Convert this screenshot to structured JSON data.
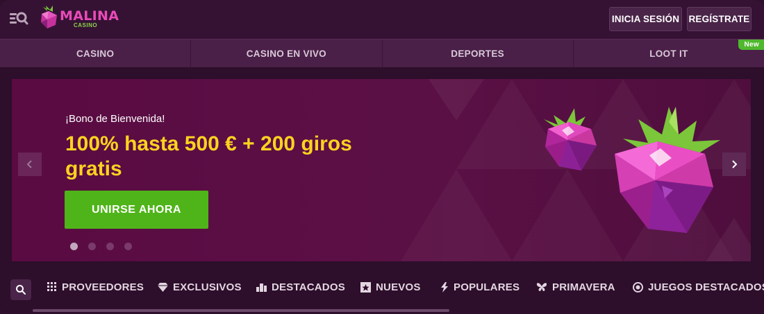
{
  "header": {
    "logo_text": "MALINA",
    "logo_sub": "CASINO",
    "login_label": "INICIA SESIÓN",
    "register_label": "REGÍSTRATE"
  },
  "nav": {
    "items": [
      {
        "label": "CASINO"
      },
      {
        "label": "CASINO EN VIVO"
      },
      {
        "label": "DEPORTES"
      },
      {
        "label": "LOOT IT",
        "badge": "New"
      }
    ]
  },
  "banner": {
    "subtitle": "¡Bono de Bienvenida!",
    "title": "100% hasta 500 € + 200 giros gratis",
    "cta": "UNIRSE AHORA",
    "slides": 4,
    "active_slide": 1
  },
  "categories": [
    {
      "label": "PROVEEDORES",
      "icon": "grid-icon"
    },
    {
      "label": "EXCLUSIVOS",
      "icon": "diamond-icon"
    },
    {
      "label": "DESTACADOS",
      "icon": "podium-icon"
    },
    {
      "label": "NUEVOS",
      "icon": "new-star-icon"
    },
    {
      "label": "POPULARES",
      "icon": "lightning-icon"
    },
    {
      "label": "PRIMAVERA",
      "icon": "butterfly-icon"
    },
    {
      "label": "JUEGOS DESTACADOS",
      "icon": "target-icon"
    }
  ],
  "colors": {
    "accent_yellow": "#ffd21f",
    "cta_green": "#4fb419",
    "brand_pink": "#e94bb8",
    "badge_green": "#4fb82e"
  }
}
